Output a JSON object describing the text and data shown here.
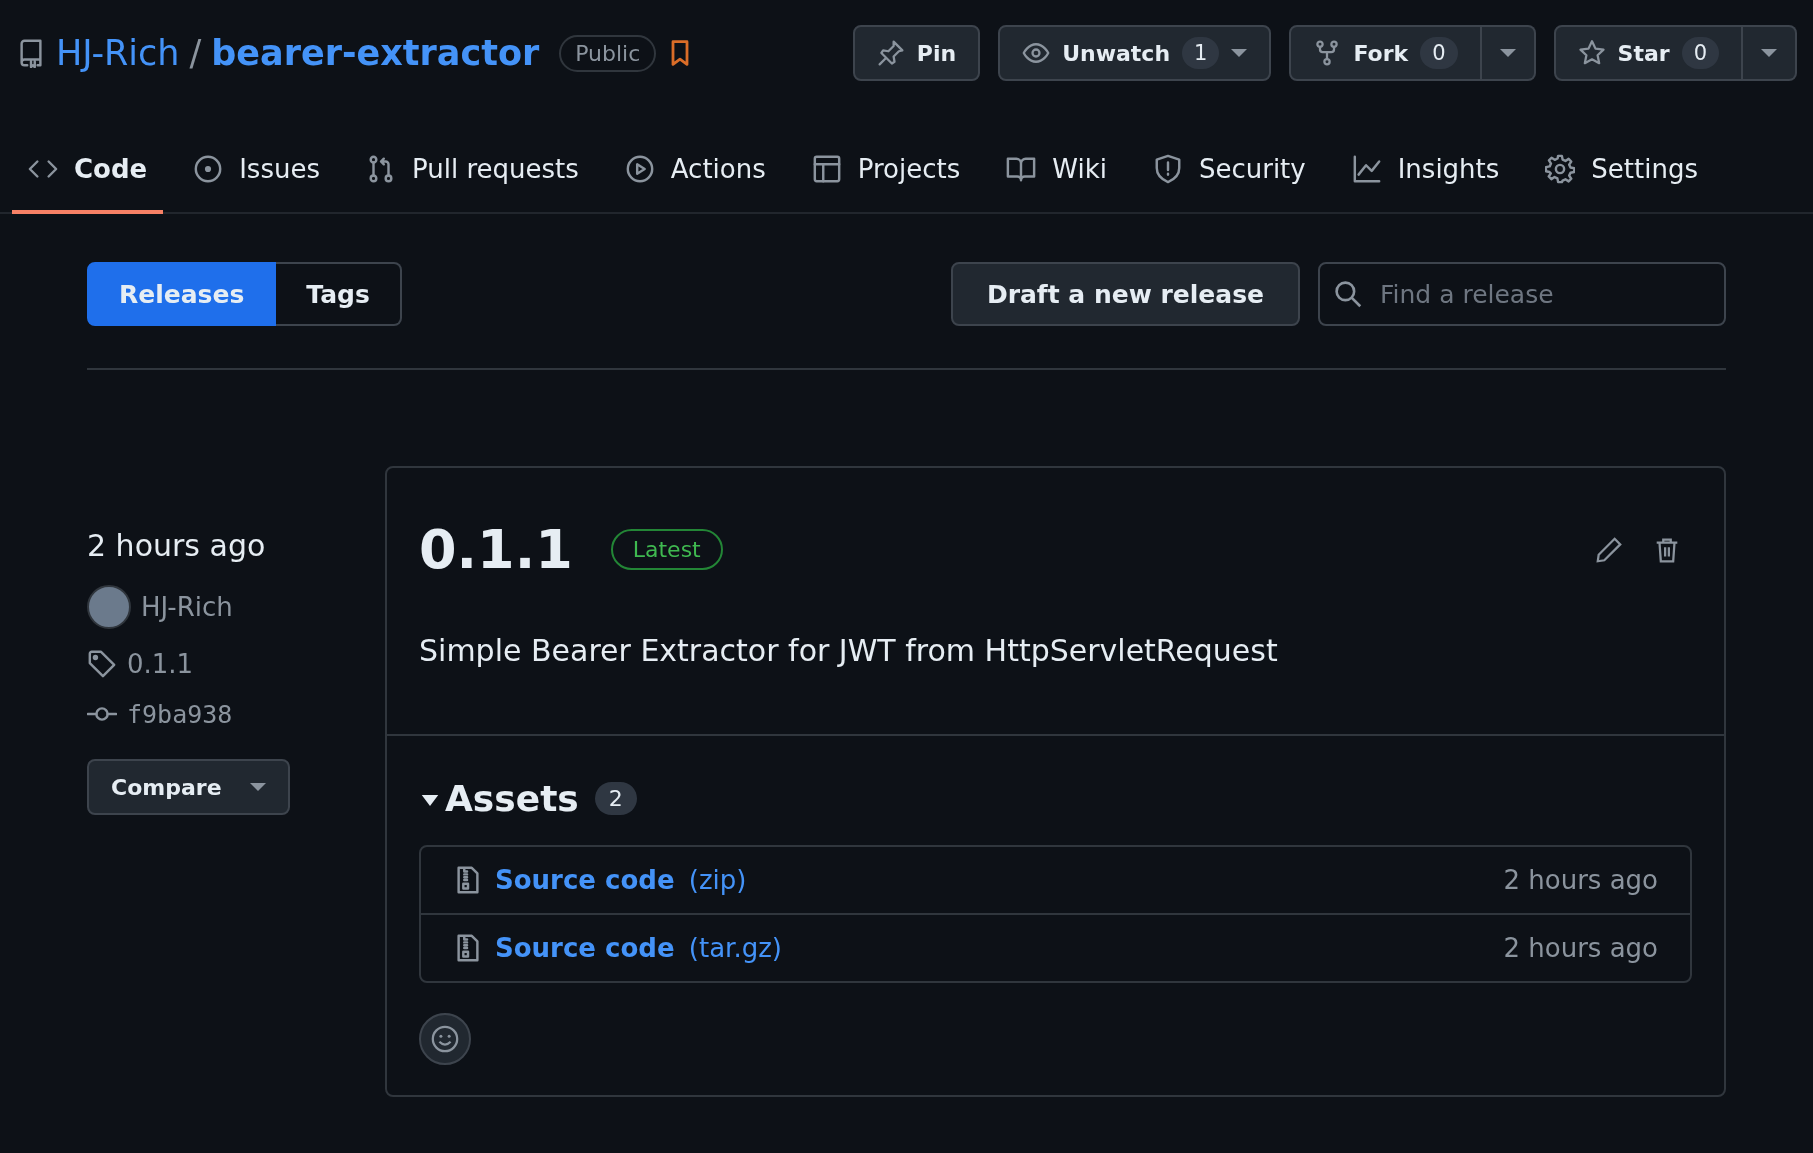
{
  "repo": {
    "owner": "HJ-Rich",
    "separator": "/",
    "name": "bearer-extractor",
    "visibility": "Public"
  },
  "repo_actions": [
    {
      "label": "Pin",
      "kind": "plain"
    },
    {
      "label": "Unwatch",
      "count": "1",
      "kind": "menu"
    },
    {
      "label": "Fork",
      "count": "0",
      "kind": "split"
    },
    {
      "label": "Star",
      "count": "0",
      "kind": "split"
    }
  ],
  "tabs": [
    {
      "label": "Code",
      "selected": true
    },
    {
      "label": "Issues",
      "selected": false
    },
    {
      "label": "Pull requests",
      "selected": false
    },
    {
      "label": "Actions",
      "selected": false
    },
    {
      "label": "Projects",
      "selected": false
    },
    {
      "label": "Wiki",
      "selected": false
    },
    {
      "label": "Security",
      "selected": false
    },
    {
      "label": "Insights",
      "selected": false
    },
    {
      "label": "Settings",
      "selected": false
    }
  ],
  "subnav": [
    {
      "label": "Releases",
      "selected": true
    },
    {
      "label": "Tags",
      "selected": false
    }
  ],
  "draft_button": "Draft a new release",
  "search": {
    "placeholder": "Find a release"
  },
  "release": {
    "time": "2 hours ago",
    "author": "HJ-Rich",
    "tag": "0.1.1",
    "commit": "f9ba938",
    "compare": "Compare",
    "title": "0.1.1",
    "badge": "Latest",
    "description": "Simple Bearer Extractor for JWT from HttpServletRequest",
    "assets": {
      "title": "Assets",
      "count": "2",
      "expanded": true,
      "items": [
        {
          "name": "Source code",
          "format": "(zip)",
          "time": "2 hours ago"
        },
        {
          "name": "Source code",
          "format": "(tar.gz)",
          "time": "2 hours ago"
        }
      ]
    }
  }
}
